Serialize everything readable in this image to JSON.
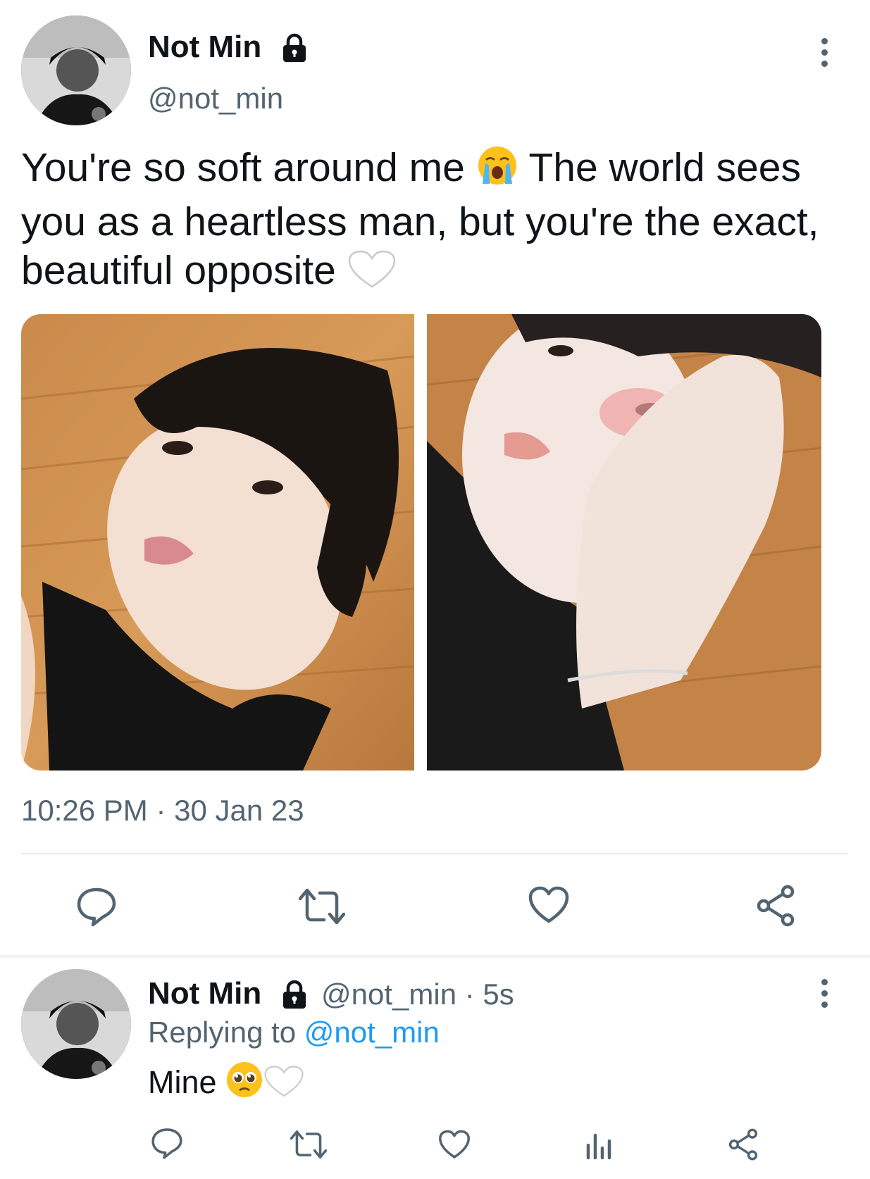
{
  "main_tweet": {
    "author_name": "Not Min",
    "author_handle": "@not_min",
    "protected_icon": "lock-icon",
    "text": {
      "part1": "You're so soft around me ",
      "emoji1": "loudly-crying-face-emoji",
      "part2": " The world sees you as a heartless man, but you're the exact, beautiful opposite ",
      "emoji2": "white-heart-emoji"
    },
    "timestamp": "10:26 PM · 30 Jan 23",
    "actions": [
      "reply-icon",
      "retweet-icon",
      "like-icon",
      "share-icon"
    ]
  },
  "reply_tweet": {
    "author_name": "Not Min",
    "author_handle_time": "@not_min · 5s",
    "replying_prefix": "Replying to ",
    "replying_handle": "@not_min",
    "text": "Mine ",
    "emojis": [
      "pleading-face-emoji",
      "white-heart-emoji"
    ],
    "actions": [
      "reply-icon",
      "retweet-icon",
      "like-icon",
      "analytics-icon",
      "share-icon"
    ]
  },
  "colors": {
    "text_primary": "#0f1419",
    "text_secondary": "#536471",
    "link": "#1d9bf0",
    "divider": "#e7e9ea"
  }
}
